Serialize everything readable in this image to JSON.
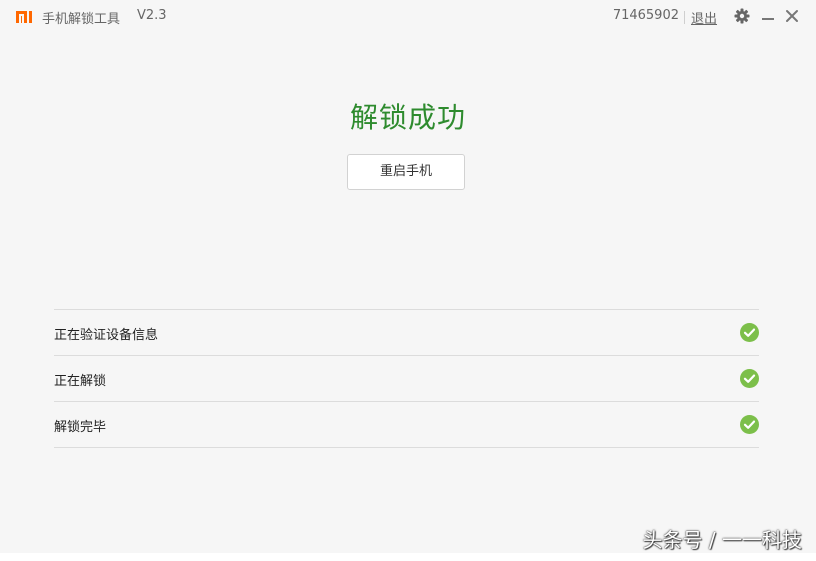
{
  "titlebar": {
    "app_title": "手机解锁工具",
    "version": "V2.3",
    "user_id": "71465902",
    "logout_label": "退出",
    "logo_icon": "mi-logo-icon",
    "settings_icon": "gear-icon",
    "minimize_icon": "minimize-icon",
    "close_icon": "close-icon",
    "brand_color": "#ff6700"
  },
  "main": {
    "result_title": "解锁成功",
    "result_color": "#2e8b2e",
    "reboot_button_label": "重启手机"
  },
  "steps": [
    {
      "label": "正在验证设备信息",
      "status": "done",
      "icon": "check-circle-icon"
    },
    {
      "label": "正在解锁",
      "status": "done",
      "icon": "check-circle-icon"
    },
    {
      "label": "解锁完毕",
      "status": "done",
      "icon": "check-circle-icon"
    }
  ],
  "check_color": "#7cbf4a",
  "watermark": {
    "text": "头条号 / 一一科技"
  }
}
